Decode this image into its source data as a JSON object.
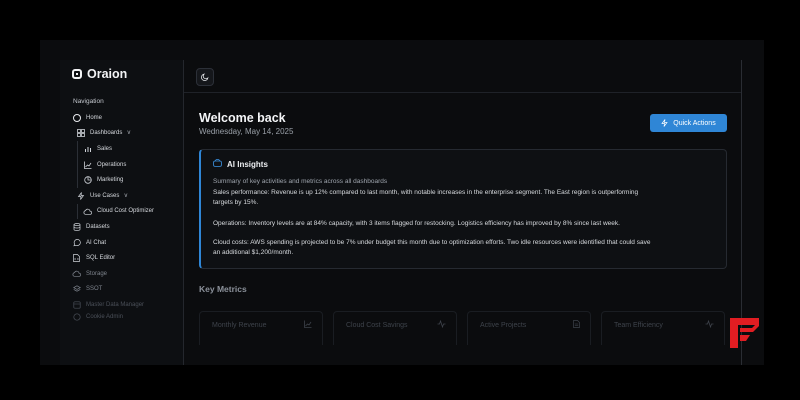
{
  "app": {
    "name": "Oraion"
  },
  "sidebar": {
    "section_title": "Navigation",
    "items": [
      {
        "label": "Home",
        "icon": "home-icon"
      },
      {
        "label": "Dashboards",
        "icon": "dashboards-icon",
        "chevron": "v"
      },
      {
        "label": "Sales",
        "icon": "bar-chart-icon"
      },
      {
        "label": "Operations",
        "icon": "line-chart-icon"
      },
      {
        "label": "Marketing",
        "icon": "pie-chart-icon"
      },
      {
        "label": "Use Cases",
        "icon": "bolt-icon",
        "chevron": "v"
      },
      {
        "label": "Cloud Cost Optimizer",
        "icon": "cloud-icon"
      },
      {
        "label": "Datasets",
        "icon": "database-icon"
      },
      {
        "label": "AI Chat",
        "icon": "chat-icon"
      },
      {
        "label": "SQL Editor",
        "icon": "file-code-icon"
      },
      {
        "label": "Storage",
        "icon": "storage-icon"
      },
      {
        "label": "SSOT",
        "icon": "layers-icon"
      },
      {
        "label": "Master Data Manager",
        "icon": "data-manager-icon"
      },
      {
        "label": "Cookie Admin",
        "icon": "cookie-icon"
      }
    ]
  },
  "header": {
    "title": "Welcome back",
    "date": "Wednesday, May 14, 2025",
    "quick_actions_label": "Quick Actions"
  },
  "insights": {
    "title": "AI Insights",
    "subtitle": "Summary of key activities and metrics across all dashboards",
    "paragraphs": [
      "Sales performance: Revenue is up 12% compared to last month, with notable increases in the enterprise segment. The East region is outperforming targets by 15%.",
      "Operations: Inventory levels are at 84% capacity, with 3 items flagged for restocking. Logistics efficiency has improved by 8% since last week.",
      "Cloud costs: AWS spending is projected to be 7% under budget this month due to optimization efforts. Two idle resources were identified that could save an additional $1,200/month."
    ]
  },
  "metrics": {
    "title": "Key Metrics",
    "cards": [
      {
        "label": "Monthly Revenue",
        "icon": "trend-icon"
      },
      {
        "label": "Cloud Cost Savings",
        "icon": "activity-icon"
      },
      {
        "label": "Active Projects",
        "icon": "document-icon"
      },
      {
        "label": "Team Efficiency",
        "icon": "pulse-icon"
      }
    ]
  },
  "colors": {
    "accent": "#2f86d6",
    "background": "#0b0c0e",
    "badge_red": "#e11d22"
  }
}
